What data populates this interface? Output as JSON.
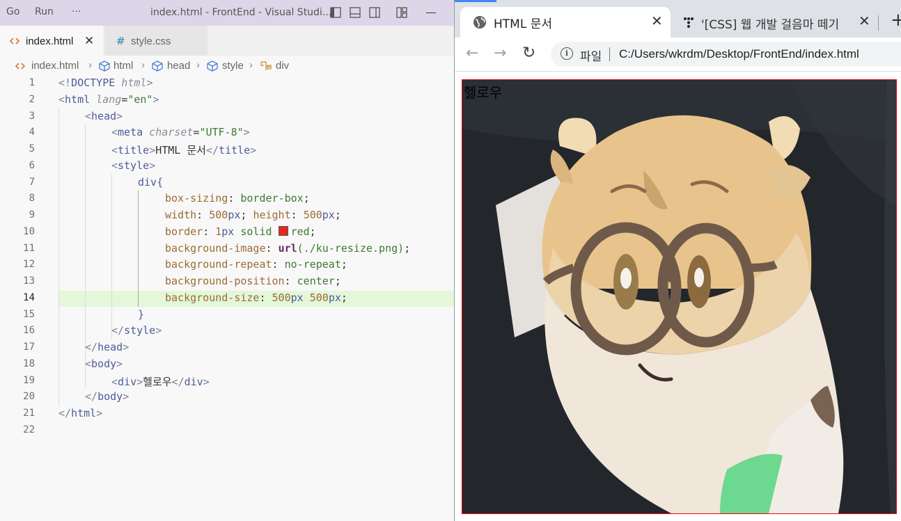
{
  "vscode": {
    "menu": [
      "Go",
      "Run",
      "···"
    ],
    "window_title": "index.html - FrontEnd - Visual Studi...",
    "tabs": [
      {
        "label": "index.html",
        "icon": "html-file-icon",
        "close": "✕"
      },
      {
        "label": "style.css",
        "icon": "css-file-icon",
        "glyph": "#"
      }
    ],
    "breadcrumb": [
      "index.html",
      "html",
      "head",
      "style",
      "div"
    ],
    "line_numbers": [
      "1",
      "2",
      "3",
      "4",
      "5",
      "6",
      "7",
      "8",
      "9",
      "10",
      "11",
      "12",
      "13",
      "14",
      "15",
      "16",
      "17",
      "18",
      "19",
      "20",
      "21",
      "22"
    ],
    "active_line": "14",
    "code": {
      "l1": {
        "a": "<!",
        "b": "DOCTYPE",
        "c": " html",
        "d": ">"
      },
      "l2": {
        "a": "<",
        "b": "html",
        "c": " lang",
        "d": "=",
        "e": "\"en\"",
        "f": ">"
      },
      "l3": {
        "a": "<",
        "b": "head",
        "c": ">"
      },
      "l4": {
        "a": "<",
        "b": "meta",
        "c": " charset",
        "d": "=",
        "e": "\"UTF-8\"",
        "f": ">"
      },
      "l5": {
        "a": "<",
        "b": "title",
        "c": ">",
        "d": "HTML 문서",
        "e": "</",
        "f": "title",
        "g": ">"
      },
      "l6": {
        "a": "<",
        "b": "style",
        "c": ">"
      },
      "l7": {
        "a": "div",
        "b": "{"
      },
      "l8": {
        "a": "box-sizing",
        "b": ": ",
        "c": "border-box",
        "d": ";"
      },
      "l9": {
        "a": "width",
        "b": ": ",
        "c": "500",
        "d": "px",
        "e": "; ",
        "f": "height",
        "g": ": ",
        "h": "500",
        "i": "px",
        "j": ";"
      },
      "l10": {
        "a": "border",
        "b": ": ",
        "c": "1",
        "d": "px",
        "e": " solid ",
        "f": "red",
        "g": ";"
      },
      "l11": {
        "a": "background-image",
        "b": ": ",
        "c": "url",
        "d": "(./ku-resize.png)",
        "e": ";"
      },
      "l12": {
        "a": "background-repeat",
        "b": ": ",
        "c": "no-repeat",
        "d": ";"
      },
      "l13": {
        "a": "background-position",
        "b": ": ",
        "c": "center",
        "d": ";"
      },
      "l14": {
        "a": "background-size",
        "b": ": ",
        "c": "500",
        "d": "px",
        "e": " ",
        "f": "500",
        "g": "px",
        "h": ";"
      },
      "l15": {
        "a": "}"
      },
      "l16": {
        "a": "</",
        "b": "style",
        "c": ">"
      },
      "l17": {
        "a": "</",
        "b": "head",
        "c": ">"
      },
      "l18": {
        "a": "<",
        "b": "body",
        "c": ">"
      },
      "l19": {
        "a": "<",
        "b": "div",
        "c": ">",
        "d": "헬로우",
        "e": "</",
        "f": "div",
        "g": ">"
      },
      "l20": {
        "a": "</",
        "b": "body",
        "c": ">"
      },
      "l21": {
        "a": "</",
        "b": "html",
        "c": ">"
      }
    },
    "colors": {
      "swatch_red": "#e32a1f",
      "titlebar": "#ddd6e8",
      "active_line_bg": "#e4f7d8"
    }
  },
  "browser": {
    "tabs": [
      {
        "title": "HTML 문서",
        "icon": "globe-icon",
        "close": "✕"
      },
      {
        "title": "'[CSS] 웹 개발 걸음마 떼기",
        "icon": "tistory-icon",
        "close": "✕"
      }
    ],
    "new_tab": "+",
    "nav": {
      "back": "←",
      "forward": "→",
      "reload": "↻"
    },
    "omnibox": {
      "info": "i",
      "scheme": "파일",
      "url": "C:/Users/wkrdm/Desktop/FrontEnd/index.html"
    },
    "page": {
      "text": "헬로우",
      "image": "plush-toy-with-glasses"
    }
  }
}
